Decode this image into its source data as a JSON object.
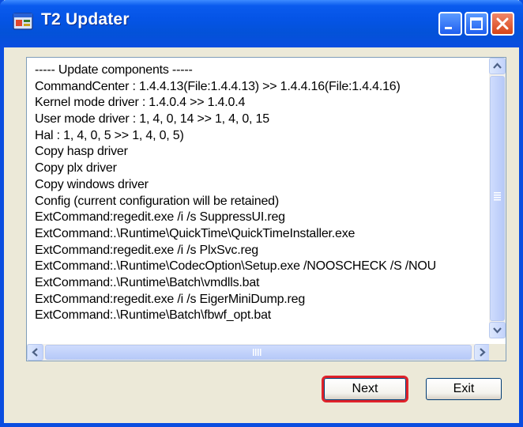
{
  "window": {
    "title": "T2 Updater"
  },
  "log": {
    "lines": [
      "----- Update components -----",
      "CommandCenter : 1.4.4.13(File:1.4.4.13) >> 1.4.4.16(File:1.4.4.16)",
      "Kernel mode driver : 1.4.0.4 >> 1.4.0.4",
      "User mode driver : 1, 4, 0, 14 >> 1, 4, 0, 15",
      "Hal : 1, 4, 0, 5 >> 1, 4, 0, 5)",
      "Copy hasp driver",
      "Copy plx driver",
      "Copy windows driver",
      "Config (current configuration will be retained)",
      "ExtCommand:regedit.exe /i /s SuppressUI.reg",
      "ExtCommand:.\\Runtime\\QuickTime\\QuickTimeInstaller.exe",
      "ExtCommand:regedit.exe /i /s PlxSvc.reg",
      "ExtCommand:.\\Runtime\\CodecOption\\Setup.exe /NOOSCHECK /S /NOU",
      "ExtCommand:.\\Runtime\\Batch\\vmdlls.bat",
      "ExtCommand:regedit.exe /i /s EigerMiniDump.reg",
      "ExtCommand:.\\Runtime\\Batch\\fbwf_opt.bat"
    ]
  },
  "buttons": {
    "next_label": "Next",
    "exit_label": "Exit"
  },
  "colors": {
    "titlebar": "#0a4de0",
    "highlight": "#e0222a",
    "close": "#d74416"
  },
  "icons": {
    "app": "app-icon",
    "minimize": "minimize-icon",
    "maximize": "maximize-icon",
    "close": "close-icon"
  }
}
